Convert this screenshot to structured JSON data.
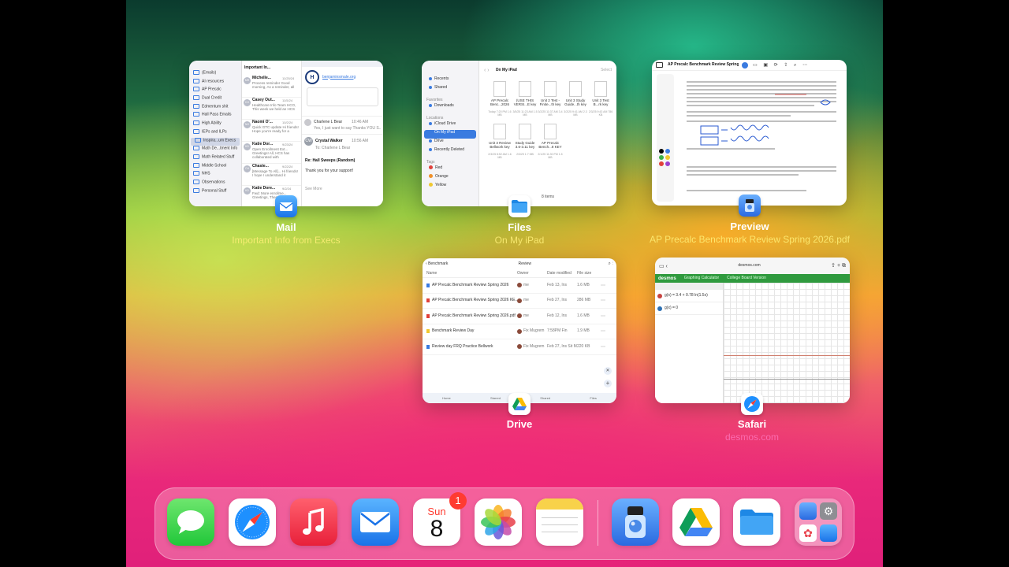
{
  "apps": {
    "mail": {
      "name": "Mail",
      "subtitle": "Important Info from Execs",
      "sidebar": [
        "(Emails)",
        "AI resources",
        "AP Precalc",
        "Dual Credit",
        "Edmentum shit",
        "Hall Pass Emails",
        "High Ability",
        "IEPs and ILPs",
        "Inspira...um Execs",
        "Math De...tment Info",
        "Math Related Stuff",
        "Middle School",
        "NHS",
        "Observations",
        "Personal Stuff"
      ],
      "list_header": "Important In...",
      "messages": [
        {
          "initials": "MR",
          "from": "Michelle...",
          "date": "11/25/24",
          "preview": "Process reminder Good morning, As a reminder, all"
        },
        {
          "initials": "CO",
          "from": "Casey Out...",
          "date": "11/5/24",
          "preview": "Healthcare Info Team HCO, This week we held an HCS"
        },
        {
          "initials": "NO",
          "from": "Naomi O'...",
          "date": "10/2/24",
          "preview": "Quick GTC update Hi friends! Hope you're ready for a"
        },
        {
          "initials": "KD",
          "from": "Katie Dor...",
          "date": "9/23/24",
          "preview": "Open Enrollment Ext... Greetings! All, HCS has collaborated with"
        },
        {
          "initials": "CH",
          "from": "Chaste...",
          "date": "9/22/24",
          "preview": "[Message To All]... Hi friends! I hope I understand it"
        },
        {
          "initials": "KD",
          "from": "Katie Dore...",
          "date": "9/2/24",
          "preview": "Fwd: More enrollme... Greetings, These eight"
        }
      ],
      "detail": {
        "link": "benjaminsmale.org",
        "reply_from": "Charlene L Bear",
        "reply_time": "10:46 AM",
        "reply_preview": "Yes, I just want to say Thanks YOU S...",
        "sender_initials": "CW",
        "sender": "Crystal Walker",
        "sender_time": "10:56 AM",
        "to": "To: Charlene L Bear",
        "subject": "Re: Hall Sweeps (Random)",
        "body": "Thank you for your support!",
        "see_more": "See More"
      }
    },
    "files": {
      "name": "Files",
      "subtitle": "On My iPad",
      "location_title": "On My iPad",
      "sidebar_top": [
        "Recents",
        "Shared"
      ],
      "favorites_label": "Favorites",
      "favorites": [
        "Downloads"
      ],
      "locations_label": "Locations",
      "locations": [
        "iCloud Drive",
        "On My iPad",
        "Drive",
        "Recently Deleted"
      ],
      "tags_label": "Tags",
      "tags": [
        {
          "name": "Red",
          "color": "#e0403a"
        },
        {
          "name": "Orange",
          "color": "#f0902a"
        },
        {
          "name": "Yellow",
          "color": "#f0c830"
        }
      ],
      "files": [
        {
          "name": "AP Precalc Benc...2026",
          "meta": "Today 7:20 PM 1.6 MB"
        },
        {
          "name": "(USE THIS VERSI...E key",
          "meta": "3/5/25 11:23 AM 1.5 MB"
        },
        {
          "name": "Unit 2 Test - Finite...th key",
          "meta": "3/2/25 11:37 AM 3.4 MB"
        },
        {
          "name": "Unit 3 Study Guide...th key",
          "meta": "3/2/25 9:41 AM 2.3 MB"
        },
        {
          "name": "Unit 3 Test B...rk key",
          "meta": "2/3/25 9:43 AM 786 KB"
        },
        {
          "name": "Unit 3 Review Bellwork key",
          "meta": "2/3/25 8:52 AM 1.6 MB"
        },
        {
          "name": "Study Guide 3.6-3.11 key",
          "meta": "2/3/25 1.7 MB"
        },
        {
          "name": "AP Precalc Bench...8 KEY",
          "meta": "2/1/25 11:30 PM 1.5 MB"
        }
      ],
      "count": "8 items",
      "select_label": "Select"
    },
    "preview": {
      "name": "Preview",
      "subtitle": "AP Precalc Benchmark Review Spring 2026.pdf",
      "doc_title": "AP Precalc Benchmark Review Spring..."
    },
    "drive": {
      "name": "Drive",
      "breadcrumb": "Benchmark",
      "title": "Review",
      "columns": [
        "Name",
        "Owner",
        "Date modified",
        "File size"
      ],
      "rows": [
        {
          "name": "AP Precalc Benchmark Review Spring 2026",
          "owner": "me",
          "date": "Feb 13, Ins",
          "size": "1.6 MB",
          "color": "#3a7be0"
        },
        {
          "name": "AP Precalc Benchmark Review Spring 2026 KE...",
          "owner": "me",
          "date": "Feb 27, Ins",
          "size": "286 MB",
          "color": "#e0403a"
        },
        {
          "name": "AP Precalc Benchmark Review Spring 2026.pdf",
          "owner": "me",
          "date": "Feb 12, Ins",
          "size": "1.6 MB",
          "color": "#e0403a"
        },
        {
          "name": "Benchmark Review Day",
          "owner": "Fix Mugrem",
          "date": "7:58PM Fin",
          "size": "1.9 MB",
          "color": "#f0c830"
        },
        {
          "name": "Review day FRQ Practice Bellwork",
          "owner": "Fix Mugrem",
          "date": "Feb 27, Ins Sit Mugrem",
          "size": "220 KB",
          "color": "#3a7be0"
        }
      ],
      "tabs": [
        "Home",
        "Starred",
        "Shared",
        "Files"
      ]
    },
    "safari": {
      "name": "Safari",
      "subtitle": "desmos.com",
      "url": "desmos.com",
      "brand": "desmos",
      "menu": [
        "Graphing Calculator",
        "College Board Version"
      ],
      "expr1": "g(x) = 3.4 + 0.78 ln(1.5x)",
      "expr2": "g(x) = 0"
    }
  },
  "dock": {
    "calendar_day": "Sun",
    "calendar_date": "8",
    "calendar_badge": "1",
    "items": [
      "Messages",
      "Safari",
      "Music",
      "Mail",
      "Calendar",
      "Photos",
      "Notes",
      "Preview",
      "Drive",
      "Files",
      "App Library"
    ]
  },
  "colors": {
    "accent_blue": "#3a7be0",
    "badge_red": "#ff3b30",
    "desmos_green": "#2f9a3e"
  }
}
